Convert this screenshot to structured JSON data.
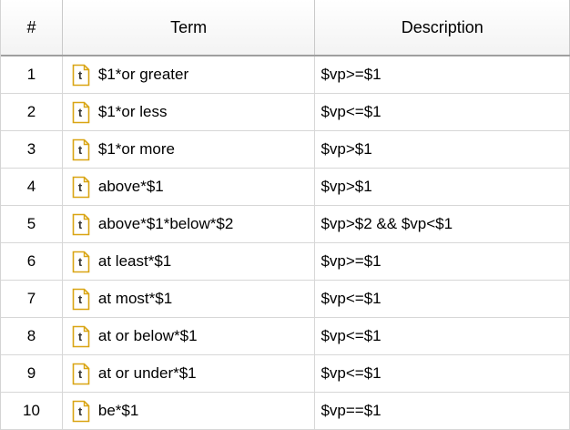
{
  "table": {
    "columns": [
      "#",
      "Term",
      "Description"
    ],
    "rows": [
      {
        "num": "1",
        "term": "$1*or greater",
        "desc": "$vp>=$1"
      },
      {
        "num": "2",
        "term": "$1*or less",
        "desc": "$vp<=$1"
      },
      {
        "num": "3",
        "term": "$1*or more",
        "desc": "$vp>$1"
      },
      {
        "num": "4",
        "term": "above*$1",
        "desc": "$vp>$1"
      },
      {
        "num": "5",
        "term": "above*$1*below*$2",
        "desc": "$vp>$2 && $vp<$1"
      },
      {
        "num": "6",
        "term": "at least*$1",
        "desc": "$vp>=$1"
      },
      {
        "num": "7",
        "term": "at most*$1",
        "desc": "$vp<=$1"
      },
      {
        "num": "8",
        "term": "at or below*$1",
        "desc": "$vp<=$1"
      },
      {
        "num": "9",
        "term": "at or under*$1",
        "desc": "$vp<=$1"
      },
      {
        "num": "10",
        "term": "be*$1",
        "desc": "$vp==$1"
      }
    ],
    "row_icon": "text-term-icon",
    "icon_letter": "t",
    "icon_color": "#d9a514"
  }
}
